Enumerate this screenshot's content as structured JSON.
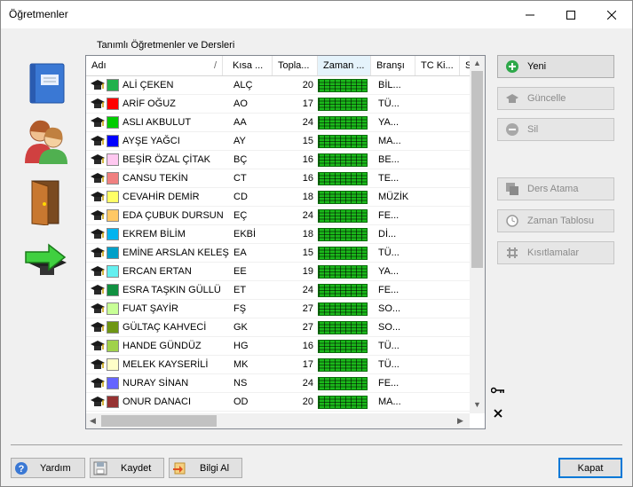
{
  "window": {
    "title": "Öğretmenler"
  },
  "group_label": "Tanımlı Öğretmenler ve Dersleri",
  "columns": [
    "Adı",
    "Kısa ...",
    "Topla...",
    "Zaman ...",
    "Branşı",
    "TC Ki...",
    "S"
  ],
  "teachers": [
    {
      "name": "ALİ ÇEKEN",
      "short": "ALÇ",
      "total": "20",
      "branch": "BİL...",
      "color": "#22b14c"
    },
    {
      "name": "ARİF OĞUZ",
      "short": "AO",
      "total": "17",
      "branch": "TÜ...",
      "color": "#ff0000"
    },
    {
      "name": "ASLI AKBULUT",
      "short": "AA",
      "total": "24",
      "branch": "YA...",
      "color": "#00cc00"
    },
    {
      "name": "AYŞE YAĞCI",
      "short": "AY",
      "total": "15",
      "branch": "MA...",
      "color": "#0000ff"
    },
    {
      "name": "BEŞİR ÖZAL ÇİTAK",
      "short": "BÇ",
      "total": "16",
      "branch": "BE...",
      "color": "#ffc8f0"
    },
    {
      "name": "CANSU TEKİN",
      "short": "CT",
      "total": "16",
      "branch": "TE...",
      "color": "#f08080"
    },
    {
      "name": "CEVAHİR DEMİR",
      "short": "CD",
      "total": "18",
      "branch": "MÜZİK",
      "color": "#ffff66"
    },
    {
      "name": "EDA ÇUBUK DURSUN",
      "short": "EÇ",
      "total": "24",
      "branch": "FE...",
      "color": "#ffc864"
    },
    {
      "name": "EKREM BİLİM",
      "short": "EKBİ",
      "total": "18",
      "branch": "Dİ...",
      "color": "#00b4f0"
    },
    {
      "name": "EMİNE ARSLAN KELEŞ",
      "short": "EA",
      "total": "15",
      "branch": "TÜ...",
      "color": "#00a0c8"
    },
    {
      "name": "ERCAN ERTAN",
      "short": "EE",
      "total": "19",
      "branch": "YA...",
      "color": "#64f0f0"
    },
    {
      "name": "ESRA TAŞKIN GÜLLÜ",
      "short": "ET",
      "total": "24",
      "branch": "FE...",
      "color": "#109040"
    },
    {
      "name": "FUAT ŞAYİR",
      "short": "FŞ",
      "total": "27",
      "branch": "SO...",
      "color": "#c8ff96"
    },
    {
      "name": "GÜLTAÇ KAHVECİ",
      "short": "GK",
      "total": "27",
      "branch": "SO...",
      "color": "#6e9614"
    },
    {
      "name": "HANDE GÜNDÜZ",
      "short": "HG",
      "total": "16",
      "branch": "TÜ...",
      "color": "#a0d24b"
    },
    {
      "name": "MELEK KAYSERİLİ",
      "short": "MK",
      "total": "17",
      "branch": "TÜ...",
      "color": "#ffffc8"
    },
    {
      "name": "NURAY SİNAN",
      "short": "NS",
      "total": "24",
      "branch": "FE...",
      "color": "#6464ff"
    },
    {
      "name": "ONUR DANACI",
      "short": "OD",
      "total": "20",
      "branch": "MA...",
      "color": "#963232"
    }
  ],
  "buttons": {
    "yeni": "Yeni",
    "guncelle": "Güncelle",
    "sil": "Sil",
    "ders_atama": "Ders Atama",
    "zaman_tablosu": "Zaman Tablosu",
    "kisitlamalar": "Kısıtlamalar"
  },
  "footer": {
    "yardim": "Yardım",
    "kaydet": "Kaydet",
    "bilgi_al": "Bilgi Al",
    "kapat": "Kapat"
  }
}
